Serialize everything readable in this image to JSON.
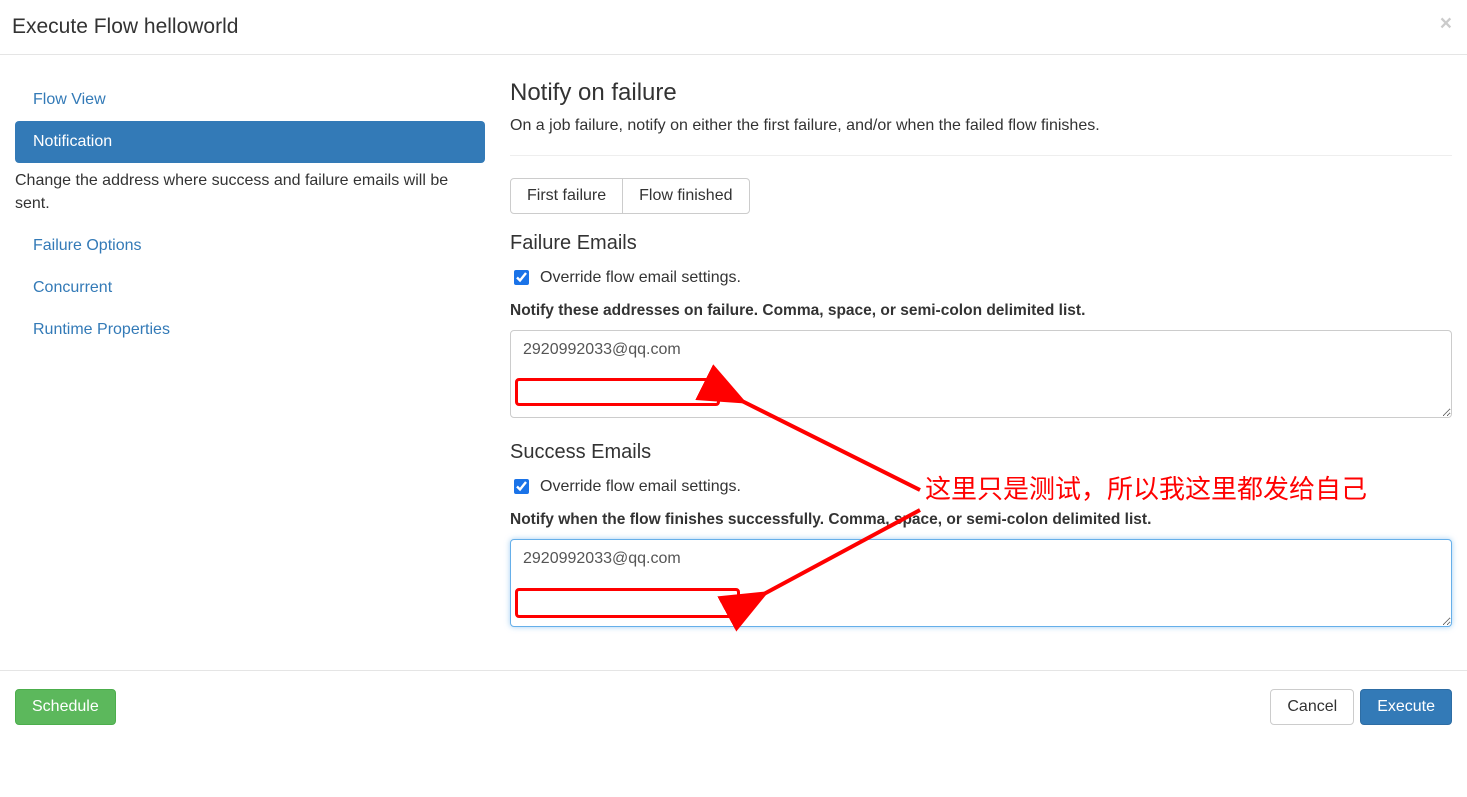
{
  "header": {
    "title": "Execute Flow helloworld"
  },
  "sidebar": {
    "items": [
      {
        "label": "Flow View",
        "active": false
      },
      {
        "label": "Notification",
        "active": true
      },
      {
        "label": "Failure Options",
        "active": false
      },
      {
        "label": "Concurrent",
        "active": false
      },
      {
        "label": "Runtime Properties",
        "active": false
      }
    ],
    "active_desc": "Change the address where success and failure emails will be sent."
  },
  "main": {
    "title": "Notify on failure",
    "subtitle": "On a job failure, notify on either the first failure, and/or when the failed flow finishes.",
    "toggle_buttons": {
      "first_failure": "First failure",
      "flow_finished": "Flow finished"
    },
    "failure_section": {
      "title": "Failure Emails",
      "override_label": "Override flow email settings.",
      "override_checked": true,
      "desc": "Notify these addresses on failure. Comma, space, or semi-colon delimited list.",
      "value": "2920992033@qq.com"
    },
    "success_section": {
      "title": "Success Emails",
      "override_label": "Override flow email settings.",
      "override_checked": true,
      "desc": "Notify when the flow finishes successfully. Comma, space, or semi-colon delimited list.",
      "value": "2920992033@qq.com"
    }
  },
  "footer": {
    "schedule": "Schedule",
    "cancel": "Cancel",
    "execute": "Execute"
  },
  "annotations": {
    "note_text": "这里只是测试，所以我这里都发给自己",
    "colors": {
      "red": "#ff0000"
    }
  }
}
